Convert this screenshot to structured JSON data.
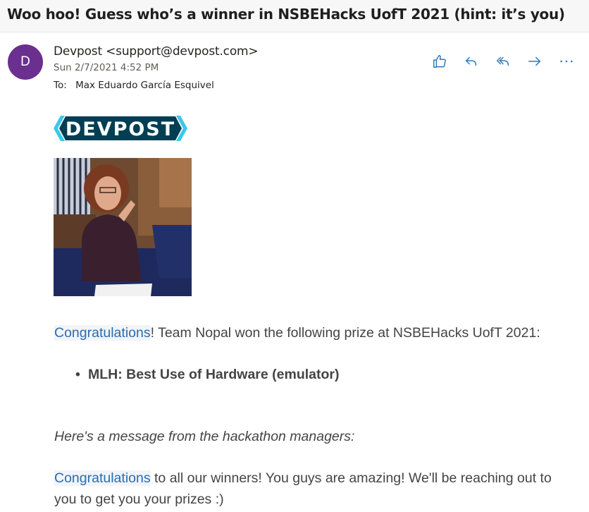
{
  "email": {
    "subject": "Woo hoo! Guess who’s a winner in NSBEHacks UofT 2021 (hint: it’s you)",
    "avatar_initial": "D",
    "sender": "Devpost <support@devpost.com>",
    "datetime": "Sun 2/7/2021 4:52 PM",
    "to_label": "To:",
    "recipient": "Max Eduardo García Esquivel"
  },
  "actions": [
    {
      "name": "like-icon"
    },
    {
      "name": "reply-icon"
    },
    {
      "name": "reply-all-icon"
    },
    {
      "name": "forward-icon"
    },
    {
      "name": "more-icon"
    }
  ],
  "body": {
    "logo_text": "DEVPOST",
    "congrats_link_1": "Congratulations",
    "line1_rest": "! Team Nopal won the following prize at NSBEHacks UofT 2021:",
    "prizes": [
      "MLH: Best Use of Hardware (emulator)"
    ],
    "manager_intro": "Here's a message from the hackathon managers:",
    "congrats_link_2": "Congratulations",
    "line4_rest": " to all our winners! You guys are amazing! We'll be reaching out to",
    "line5": "you to get you your prizes :)"
  },
  "colors": {
    "accent": "#2b6cb0",
    "avatar": "#6b2f8f",
    "logo_dark": "#003e54",
    "logo_accent": "#3dc8e6"
  }
}
